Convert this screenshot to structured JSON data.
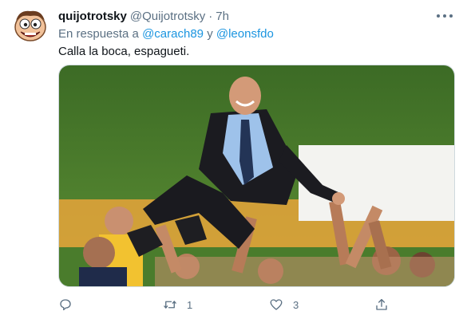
{
  "tweet": {
    "display_name": "quijotrotsky",
    "handle": "@Quijotrotsky",
    "separator": "·",
    "time": "7h",
    "reply_prefix": "En respuesta a",
    "reply_to": [
      "@carach89",
      "@leonsfdo"
    ],
    "reply_conjunction": "y",
    "text": "Calla la boca, espagueti.",
    "media_alt": "Photo of a smiling man in a suit being tossed in the air by players celebrating"
  },
  "actions": {
    "reply": {
      "icon": "reply-icon",
      "count": ""
    },
    "retweet": {
      "icon": "retweet-icon",
      "count": "1"
    },
    "like": {
      "icon": "heart-icon",
      "count": "3"
    },
    "share": {
      "icon": "share-icon",
      "count": ""
    }
  },
  "colors": {
    "link": "#1b95e0",
    "secondary_text": "#5b7083",
    "icon": "#5b7083"
  }
}
